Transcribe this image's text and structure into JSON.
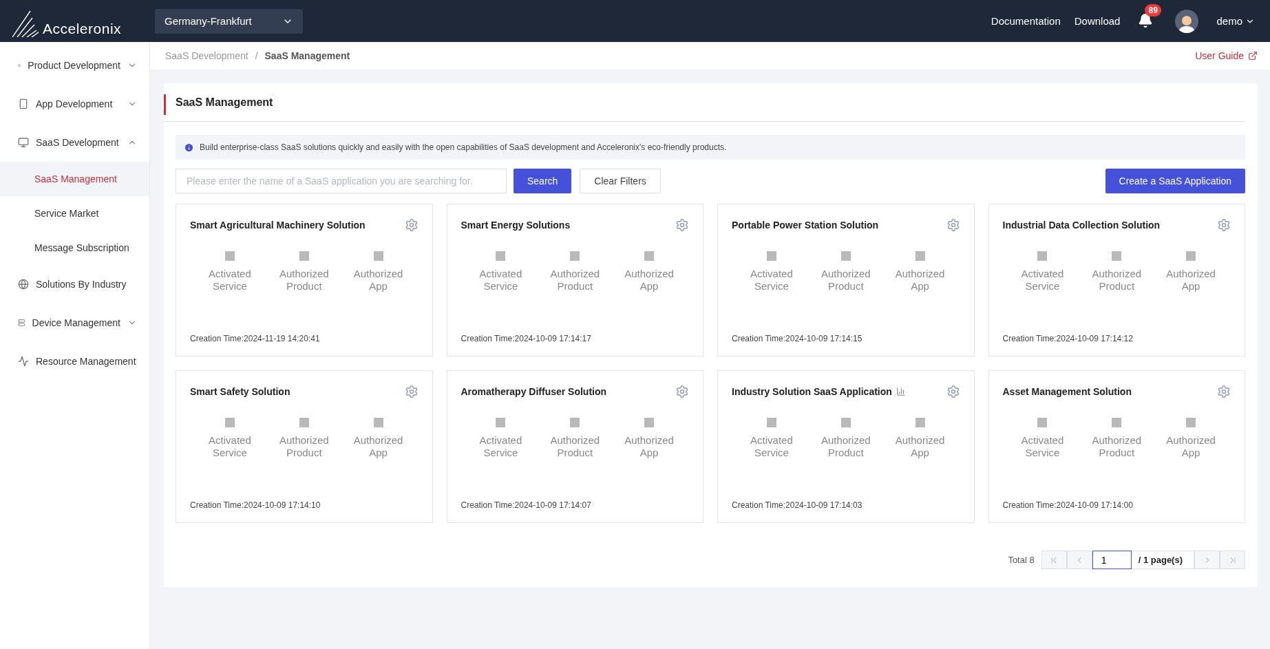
{
  "header": {
    "logo_text": "Acceleronix",
    "region": "Germany-Frankfurt",
    "links": [
      "Documentation",
      "Download"
    ],
    "notification_count": "89",
    "user": "demo"
  },
  "sidebar": {
    "items": [
      {
        "label": "Product Development",
        "expanded": false,
        "selected": false
      },
      {
        "label": "App Development",
        "expanded": false,
        "selected": false
      },
      {
        "label": "SaaS Development",
        "expanded": true,
        "selected": false,
        "children": [
          {
            "label": "SaaS Management",
            "selected": true
          },
          {
            "label": "Service Market",
            "selected": false
          },
          {
            "label": "Message Subscription",
            "selected": false
          }
        ]
      },
      {
        "label": "Solutions By Industry",
        "selected": false
      },
      {
        "label": "Device Management",
        "expanded": false,
        "selected": false
      },
      {
        "label": "Resource Management",
        "selected": false
      }
    ]
  },
  "breadcrumb": [
    "SaaS Development",
    "SaaS Management"
  ],
  "breadcrumb_separator": "/",
  "user_guide": "User Guide",
  "page_title": "SaaS Management",
  "notice": "Build enterprise-class SaaS solutions quickly and easily with the open capabilities of SaaS development and Acceleronix's eco-friendly products.",
  "search": {
    "placeholder": "Please enter the name of a SaaS application you are searching for.",
    "button": "Search",
    "clear": "Clear Filters"
  },
  "create_button": "Create a SaaS Application",
  "cards": [
    {
      "title": "Smart Agricultural Machinery Solution",
      "chart_icon": false,
      "stats": [
        "Activated Service",
        "Authorized Product",
        "Authorized App"
      ],
      "created": "Creation Time:2024-11-19 14:20:41"
    },
    {
      "title": "Smart Energy Solutions",
      "chart_icon": false,
      "stats": [
        "Activated Service",
        "Authorized Product",
        "Authorized App"
      ],
      "created": "Creation Time:2024-10-09 17:14:17"
    },
    {
      "title": "Portable Power Station Solution",
      "chart_icon": false,
      "stats": [
        "Activated Service",
        "Authorized Product",
        "Authorized App"
      ],
      "created": "Creation Time:2024-10-09 17:14:15"
    },
    {
      "title": "Industrial Data Collection Solution",
      "chart_icon": false,
      "stats": [
        "Activated Service",
        "Authorized Product",
        "Authorized App"
      ],
      "created": "Creation Time:2024-10-09 17:14:12"
    },
    {
      "title": "Smart Safety Solution",
      "chart_icon": false,
      "stats": [
        "Activated Service",
        "Authorized Product",
        "Authorized App"
      ],
      "created": "Creation Time:2024-10-09 17:14:10"
    },
    {
      "title": "Aromatherapy Diffuser Solution",
      "chart_icon": false,
      "stats": [
        "Activated Service",
        "Authorized Product",
        "Authorized App"
      ],
      "created": "Creation Time:2024-10-09 17:14:07"
    },
    {
      "title": "Industry Solution SaaS Application",
      "chart_icon": true,
      "stats": [
        "Activated Service",
        "Authorized Product",
        "Authorized App"
      ],
      "created": "Creation Time:2024-10-09 17:14:03"
    },
    {
      "title": "Asset Management Solution",
      "chart_icon": false,
      "stats": [
        "Activated Service",
        "Authorized Product",
        "Authorized App"
      ],
      "created": "Creation Time:2024-10-09 17:14:00"
    }
  ],
  "pagination": {
    "total": "Total 8",
    "page": "1",
    "pages": "/ 1 page(s)",
    "first_disabled": true,
    "prev_disabled": true,
    "next_disabled": true,
    "last_disabled": true
  }
}
